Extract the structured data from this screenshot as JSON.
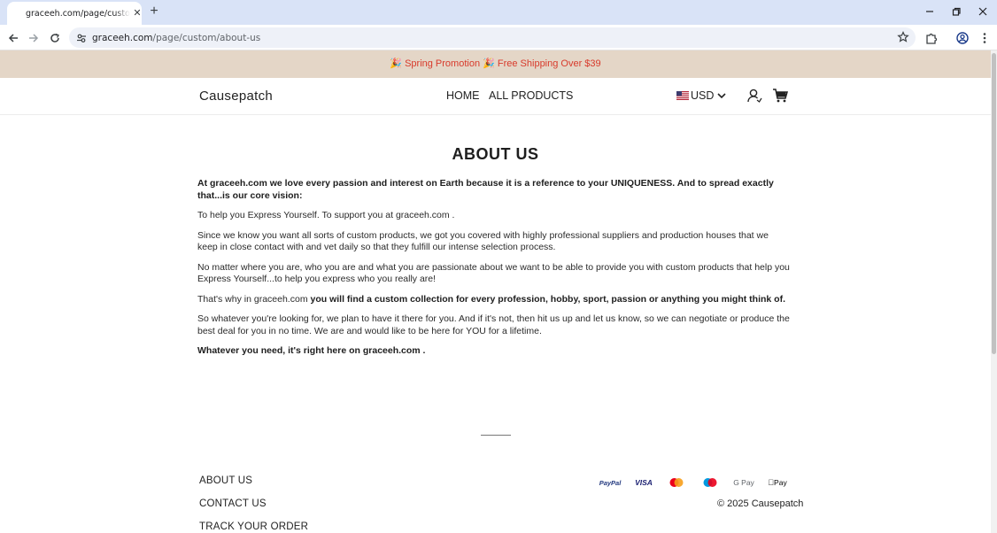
{
  "browser": {
    "tab": {
      "title": "graceeh.com/page/custom/about-us"
    },
    "address": {
      "domain": "graceeh.com",
      "path": "/page/custom/about-us"
    }
  },
  "promo": {
    "text": "🎉 Spring Promotion 🎉  Free Shipping Over $39"
  },
  "header": {
    "brand": "Causepatch",
    "nav": [
      {
        "label": "HOME"
      },
      {
        "label": "ALL PRODUCTS"
      }
    ],
    "currency": "USD"
  },
  "page": {
    "title": "ABOUT US",
    "paragraphs": {
      "p1": "At graceeh.com  we love every passion and interest on Earth because it is a reference to your UNIQUENESS. And to spread exactly that...is our core vision:",
      "p2": "To help you Express Yourself. To support you at graceeh.com .",
      "p3": "Since we know you want all sorts of custom products, we got you covered with highly professional suppliers and production houses that we keep in close contact with and vet daily so that they fulfill our intense selection process.",
      "p4": "No matter where you are, who you are and what you are passionate about we want to be able to provide you with custom products that help you Express Yourself...to help you express who you really are!",
      "p5_a": "That's why in graceeh.com ",
      "p5_b": " you will find a custom collection for every profession, hobby, sport, passion or anything you might think of.",
      "p6": "So whatever you're looking for, we plan to have it there for you. And if it's not, then hit us up and let us know, so we can negotiate or produce the best deal for you in no time. We are and would like to be here for YOU for a lifetime.",
      "p7": "Whatever you need, it's right here on graceeh.com ."
    }
  },
  "footer": {
    "links": [
      {
        "label": "ABOUT US"
      },
      {
        "label": "CONTACT US"
      },
      {
        "label": "TRACK YOUR ORDER"
      }
    ],
    "payments": {
      "paypal": "PayPal",
      "visa": "VISA",
      "gpay": "G Pay",
      "applepay": "Pay"
    },
    "copyright": "© 2025 Causepatch"
  }
}
